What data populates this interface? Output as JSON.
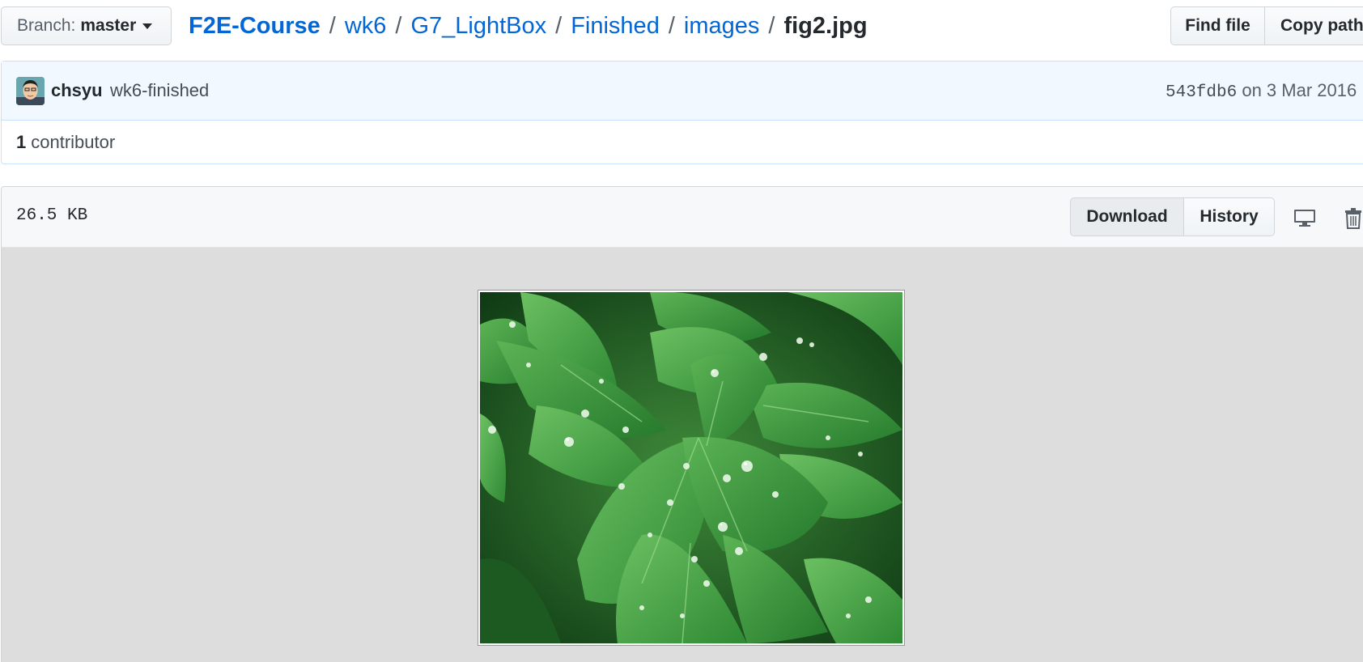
{
  "branch": {
    "label": "Branch:",
    "name": "master"
  },
  "breadcrumb": {
    "root": "F2E-Course",
    "parts": [
      "wk6",
      "G7_LightBox",
      "Finished",
      "images"
    ],
    "separator": "/",
    "file": "fig2.jpg"
  },
  "toolbar": {
    "find_file": "Find file",
    "copy_path": "Copy path"
  },
  "commit": {
    "author": "chsyu",
    "message": "wk6-finished",
    "sha": "543fdb6",
    "date_text": "on 3 Mar 2016"
  },
  "contributors": {
    "count": "1",
    "label": "contributor"
  },
  "file": {
    "size": "26.5 KB",
    "download_label": "Download",
    "history_label": "History",
    "icons": [
      "desktop-icon",
      "trash-icon"
    ]
  },
  "colors": {
    "link": "#0366d6",
    "commit_bg": "#f1f8ff",
    "commit_border": "#c8e1ff",
    "image_backdrop": "#dddddd"
  }
}
